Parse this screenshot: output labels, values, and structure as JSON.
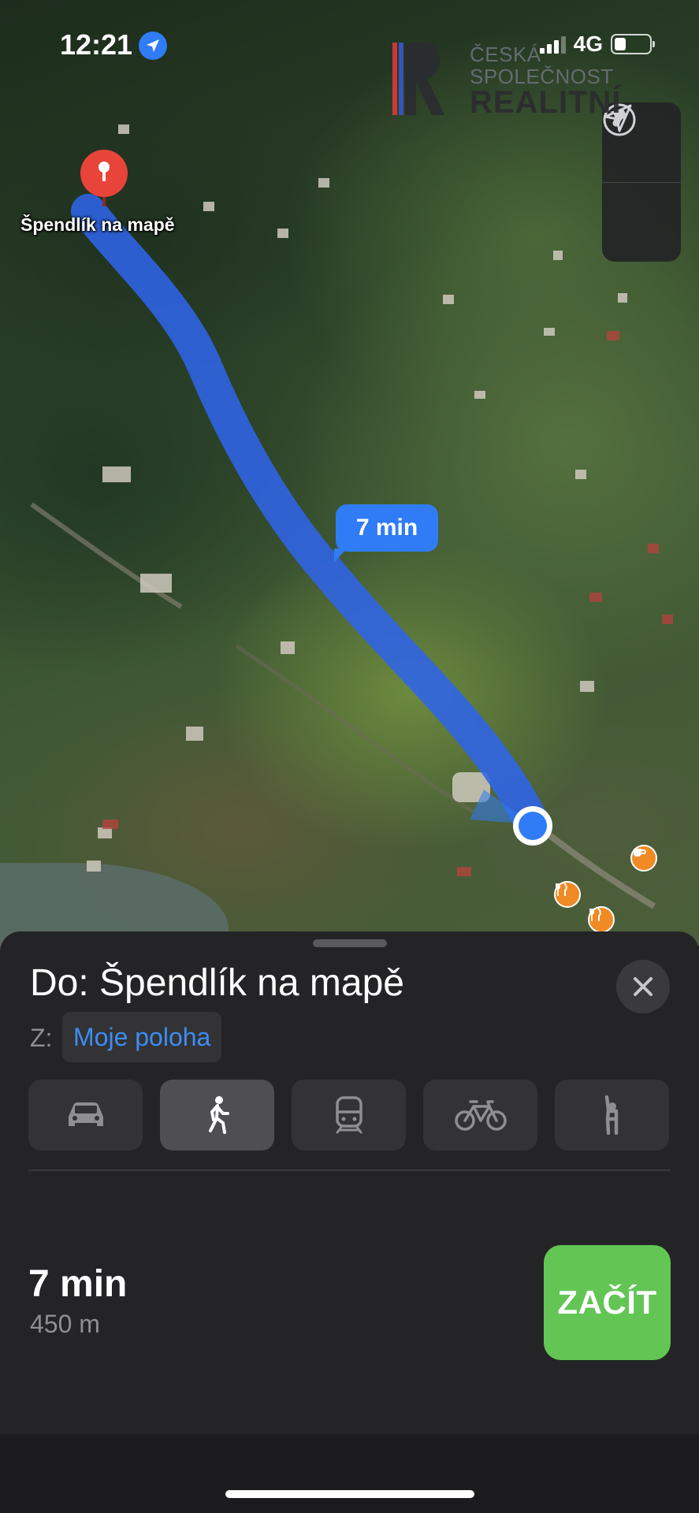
{
  "status_bar": {
    "time": "12:21",
    "network": "4G",
    "location_active": true
  },
  "watermark": {
    "line1": "ČESKÁ",
    "line2": "SPOLEČNOST",
    "line3": "REALITNÍ"
  },
  "map": {
    "destination_pin_label": "Špendlík na mapě",
    "route_time_bubble": "7 min",
    "controls": [
      "globe-icon",
      "location-arrow-icon"
    ],
    "poi_icons": [
      "coffee-icon",
      "restaurant-icon",
      "restaurant-icon"
    ],
    "route_color": "#2f7cf6",
    "pin_color": "#e8443a"
  },
  "directions_sheet": {
    "title": "Do: Špendlík na mapě",
    "from_label": "Z:",
    "from_value": "Moje poloha",
    "transport_modes": [
      {
        "icon": "car-icon",
        "active": false
      },
      {
        "icon": "walking-icon",
        "active": true
      },
      {
        "icon": "transit-icon",
        "active": false
      },
      {
        "icon": "bicycle-icon",
        "active": false
      },
      {
        "icon": "rideshare-icon",
        "active": false
      }
    ],
    "eta": "7 min",
    "distance": "450 m",
    "start_button_label": "ZAČÍT",
    "accent_color": "#3d8df6",
    "start_button_color": "#62c554"
  }
}
